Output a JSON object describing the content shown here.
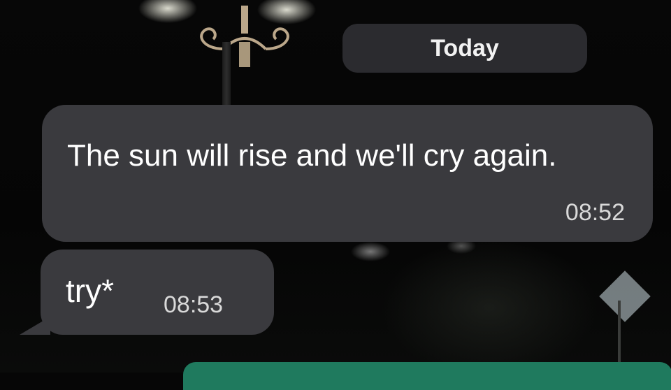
{
  "date_separator": "Today",
  "messages": [
    {
      "text": "The sun will rise and we'll cry again.",
      "time": "08:52"
    },
    {
      "text": "try*",
      "time": "08:53"
    }
  ],
  "colors": {
    "bubble": "#3a3a3e",
    "date_pill": "#2b2b2f",
    "input_bar": "#1f7a5e"
  }
}
